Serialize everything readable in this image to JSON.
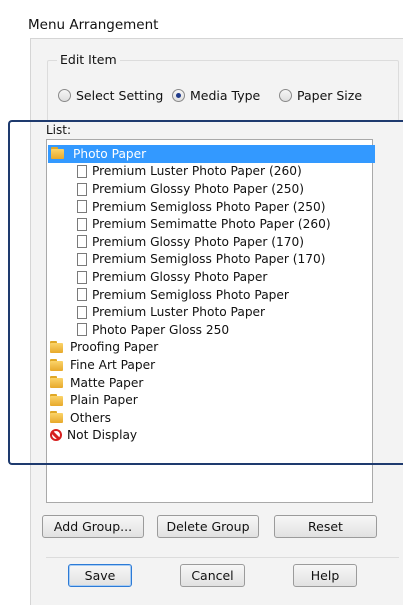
{
  "window": {
    "title": "Menu Arrangement"
  },
  "edit_item": {
    "label": "Edit Item",
    "options": [
      {
        "label": "Select Setting",
        "selected": false
      },
      {
        "label": "Media Type",
        "selected": true
      },
      {
        "label": "Paper Size",
        "selected": false
      }
    ]
  },
  "list": {
    "label": "List:",
    "items": [
      {
        "type": "folder",
        "label": "Photo Paper",
        "level": 0,
        "selected": true
      },
      {
        "type": "doc",
        "label": "Premium Luster Photo Paper (260)",
        "level": 1
      },
      {
        "type": "doc",
        "label": "Premium Glossy Photo Paper (250)",
        "level": 1
      },
      {
        "type": "doc",
        "label": "Premium Semigloss Photo Paper (250)",
        "level": 1
      },
      {
        "type": "doc",
        "label": "Premium Semimatte Photo Paper (260)",
        "level": 1
      },
      {
        "type": "doc",
        "label": "Premium Glossy Photo Paper (170)",
        "level": 1
      },
      {
        "type": "doc",
        "label": "Premium Semigloss Photo Paper (170)",
        "level": 1
      },
      {
        "type": "doc",
        "label": "Premium Glossy Photo Paper",
        "level": 1
      },
      {
        "type": "doc",
        "label": "Premium Semigloss Photo Paper",
        "level": 1
      },
      {
        "type": "doc",
        "label": "Premium Luster Photo Paper",
        "level": 1
      },
      {
        "type": "doc",
        "label": "Photo Paper Gloss 250",
        "level": 1
      },
      {
        "type": "folder",
        "label": "Proofing Paper",
        "level": 0
      },
      {
        "type": "folder",
        "label": "Fine Art Paper",
        "level": 0
      },
      {
        "type": "folder",
        "label": "Matte Paper",
        "level": 0
      },
      {
        "type": "folder",
        "label": "Plain Paper",
        "level": 0
      },
      {
        "type": "folder",
        "label": "Others",
        "level": 0
      },
      {
        "type": "nodisplay",
        "label": "Not Display",
        "level": 0
      }
    ]
  },
  "actions": {
    "add_group": "Add Group...",
    "delete_group": "Delete Group",
    "reset": "Reset"
  },
  "footer": {
    "save": "Save",
    "cancel": "Cancel",
    "help": "Help"
  },
  "colors": {
    "selection": "#3399ff",
    "highlight_frame": "#1e3a6e",
    "no_display_icon": "#d62020"
  }
}
